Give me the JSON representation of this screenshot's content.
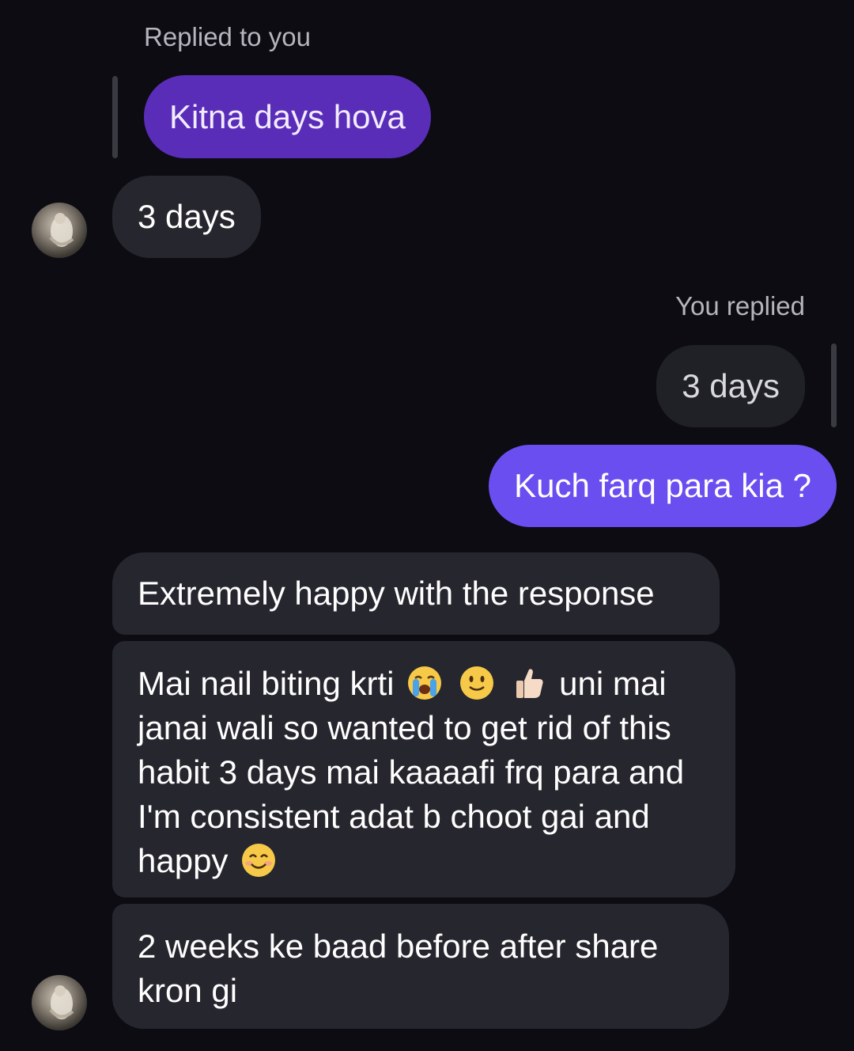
{
  "conversation": {
    "reply_to_you_label": "Replied to you",
    "quoted_outgoing": "Kitna days hova",
    "incoming_1": "3 days",
    "you_replied_label": "You replied",
    "quoted_incoming": "3 days",
    "outgoing_1": "Kuch farq para kia ?",
    "incoming_2": "Extremely happy with the response",
    "incoming_3": {
      "line1_before_emojis": "Mai nail biting krti",
      "emojis": [
        "loudly-crying-face-icon",
        "slightly-smiling-face-icon",
        "thumbs-up-icon"
      ],
      "line1_after_emojis": "uni mai",
      "rest": "janai wali so wanted to get rid of this habit 3 days mai kaaaafi frq para and I'm consistent adat b choot gai and happy",
      "trailing_emoji": "smiling-face-with-smiling-eyes-icon"
    },
    "incoming_4": "2 weeks ke baad before after share kron gi"
  },
  "colors": {
    "background": "#0c0c12",
    "incoming_bubble": "#26262e",
    "outgoing_bubble": "#6a4ef0",
    "quoted_outgoing_bubble": "#5a2db8",
    "label_text": "#b5b5bd"
  }
}
